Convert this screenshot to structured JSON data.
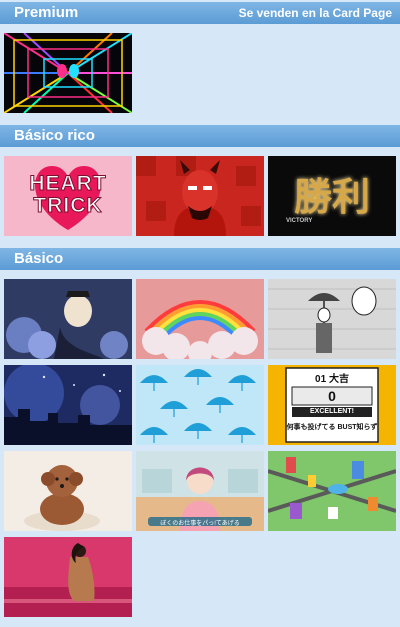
{
  "sections": {
    "premium": {
      "title": "Premium",
      "note": "Se venden en la Card Page"
    },
    "basico_rico": {
      "title": "Básico rico"
    },
    "basico": {
      "title": "Básico"
    }
  },
  "cards": {
    "heart_trick": {
      "line1": "HEART",
      "line2": "TRICK"
    },
    "victory": {
      "kanji": "勝利",
      "latin": "VICTORY"
    },
    "scoreboard": {
      "top": "01 大吉",
      "score": "0",
      "label": "EXCELLENT!",
      "bottom": "何事も投げてる BUST知らず"
    },
    "anime_caption": "ぼくのお仕事をパっ!てあげる"
  },
  "colors": {
    "header": "#5b9bd5",
    "background": "#d6e8f7"
  }
}
